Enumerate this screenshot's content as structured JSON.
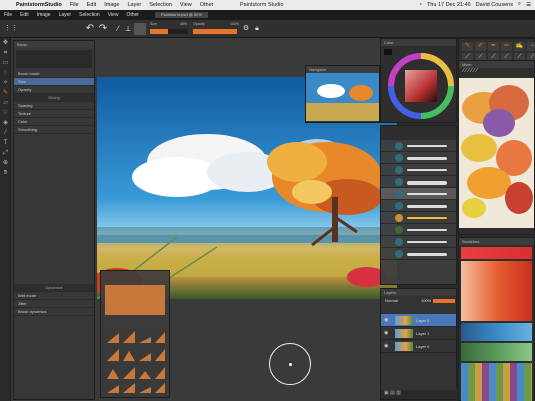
{
  "mac_menubar": {
    "app_name": "PaintstormStudio",
    "menus": [
      "File",
      "Edit",
      "Image",
      "Layer",
      "Selection",
      "View",
      "Other"
    ],
    "window_title": "Paintstorm Studio",
    "clock": "Thu 17 Dec 21:46",
    "user": "David Cousens"
  },
  "app_menubar": {
    "menus": [
      "File",
      "Edit",
      "Image",
      "Layer",
      "Selection",
      "View",
      "Other"
    ],
    "document_tab": "Paintstorm.psd @ 50%"
  },
  "toolbar": {
    "undo_icon": "undo-icon",
    "redo_icon": "redo-icon",
    "size_label": "Size",
    "size_value": "48%",
    "size_level": 0.48,
    "opacity_label": "Opacity",
    "opacity_value": "100%",
    "opacity_level": 1.0
  },
  "tools": [
    "move-icon",
    "crop-icon",
    "selection-icon",
    "lasso-icon",
    "magic-wand-icon",
    "brush-icon",
    "eraser-icon",
    "smudge-icon",
    "fill-icon",
    "picker-icon",
    "text-icon",
    "transform-icon",
    "zoom-icon",
    "hand-icon"
  ],
  "brush_panel": {
    "title": "Brush",
    "rows": [
      {
        "label": "Brush mode",
        "value": ""
      },
      {
        "label": "Size",
        "value": ""
      },
      {
        "label": "Opacity",
        "value": ""
      },
      {
        "label": "Spacing",
        "value": ""
      },
      {
        "label": "Texture",
        "value": ""
      },
      {
        "label": "Color",
        "value": ""
      },
      {
        "label": "Smoothing",
        "value": ""
      }
    ],
    "mixing_header": "Mixing",
    "dynamics_header": "Dynamics",
    "bottom_rows": [
      "Wet mode",
      "Jitter",
      "Brush dynamics"
    ]
  },
  "nav_panel": {
    "title": "Navigator"
  },
  "color_panel": {
    "title": "Color"
  },
  "layers_panel": {
    "title": "Layers",
    "blend_mode": "Normal",
    "opacity": "100%",
    "layers": [
      {
        "name": "Layer 2",
        "selected": true
      },
      {
        "name": "Layer 1",
        "selected": false
      },
      {
        "name": "Layer 0",
        "selected": false
      }
    ]
  },
  "mixer_panel": {
    "title": "Mixer"
  },
  "swatch_panel": {
    "title": "Swatches"
  },
  "colors": {
    "accent": "#e8742b",
    "selection": "#4a78b8"
  }
}
